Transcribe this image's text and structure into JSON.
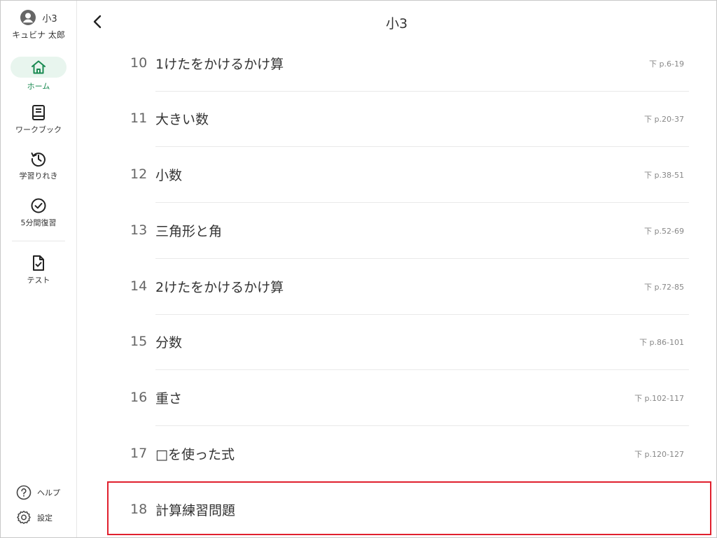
{
  "user": {
    "grade": "小3",
    "name": "キュビナ 太郎"
  },
  "sidebar": {
    "items": [
      {
        "label": "ホーム",
        "icon": "home-icon"
      },
      {
        "label": "ワークブック",
        "icon": "book-icon"
      },
      {
        "label": "学習りれき",
        "icon": "history-icon"
      },
      {
        "label": "5分間復習",
        "icon": "check-circle-icon"
      },
      {
        "label": "テスト",
        "icon": "test-doc-icon"
      }
    ],
    "help_label": "ヘルプ",
    "settings_label": "設定"
  },
  "header": {
    "title": "小3"
  },
  "units": [
    {
      "num": "10",
      "title": "1けたをかけるかけ算",
      "page": "下 p.6-19"
    },
    {
      "num": "11",
      "title": "大きい数",
      "page": "下 p.20-37"
    },
    {
      "num": "12",
      "title": "小数",
      "page": "下 p.38-51"
    },
    {
      "num": "13",
      "title": "三角形と角",
      "page": "下 p.52-69"
    },
    {
      "num": "14",
      "title": "2けたをかけるかけ算",
      "page": "下 p.72-85"
    },
    {
      "num": "15",
      "title": "分数",
      "page": "下 p.86-101"
    },
    {
      "num": "16",
      "title": "重さ",
      "page": "下 p.102-117"
    },
    {
      "num": "17",
      "title": "□を使った式",
      "page": "下 p.120-127"
    },
    {
      "num": "18",
      "title": "計算練習問題",
      "page": ""
    }
  ],
  "colors": {
    "accent": "#1a8a52",
    "highlight": "#e0202e"
  }
}
